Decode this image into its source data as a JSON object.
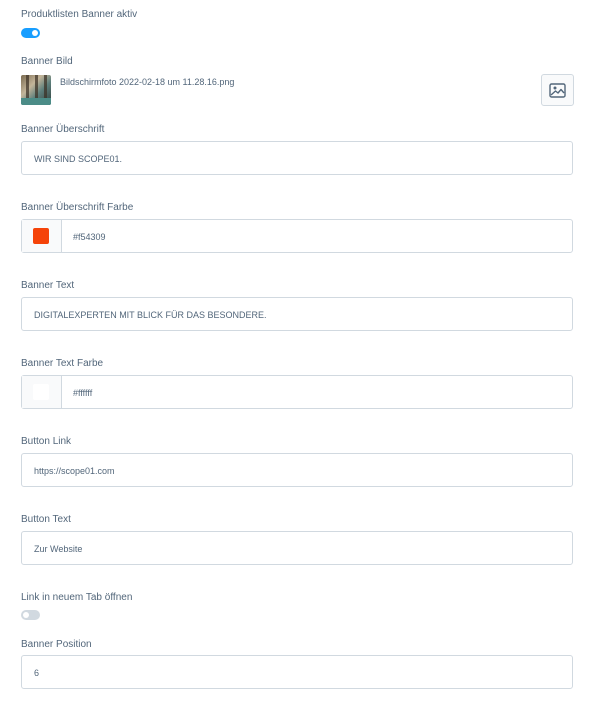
{
  "banner_active": {
    "label": "Produktlisten Banner aktiv",
    "enabled": true
  },
  "banner_image": {
    "label": "Banner Bild",
    "filename": "Bildschirmfoto 2022-02-18 um 11.28.16.png",
    "button_icon": "image-icon"
  },
  "banner_heading": {
    "label": "Banner Überschrift",
    "value": "WIR SIND SCOPE01."
  },
  "banner_heading_color": {
    "label": "Banner Überschrift Farbe",
    "value": "#f54309",
    "swatch": "#f54309"
  },
  "banner_text": {
    "label": "Banner Text",
    "value": "DIGITALEXPERTEN MIT BLICK FÜR DAS BESONDERE."
  },
  "banner_text_color": {
    "label": "Banner Text Farbe",
    "value": "#ffffff",
    "swatch": "#ffffff"
  },
  "button_link": {
    "label": "Button Link",
    "value": "https://scope01.com"
  },
  "button_text": {
    "label": "Button Text",
    "value": "Zur Website"
  },
  "new_tab": {
    "label": "Link in neuem Tab öffnen",
    "enabled": false
  },
  "banner_position": {
    "label": "Banner Position",
    "value": "6"
  },
  "colors": {
    "accent": "#189eff",
    "toggle_off": "#d1d9e0",
    "border": "#d1d9e0",
    "text": "#52667a"
  }
}
